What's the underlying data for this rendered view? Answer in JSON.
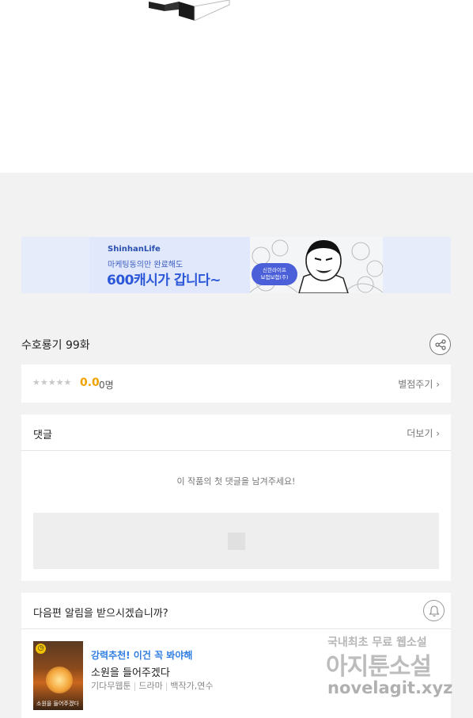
{
  "ad": {
    "brand": "ShinhanLife",
    "subline": "마케팅동의만 완료해도",
    "headline": "600캐시가 갑니다~",
    "badge_line1": "신한라이프",
    "badge_line2": "보험보험(주)"
  },
  "episode": {
    "title": "수호룡기 99화"
  },
  "rating": {
    "stars": "★★★★★",
    "score": "0.0",
    "count": "0명",
    "rate_label": "별점주기 ›"
  },
  "comments": {
    "title": "댓글",
    "more_label": "더보기 ›",
    "empty_message": "이 작품의 첫 댓글을 남겨주세요!"
  },
  "notify": {
    "question": "다음편 알림을 받으시겠습니까?"
  },
  "recommendation": {
    "tag": "강력추천! 이건 꼭 봐야해",
    "title": "소원을 들어주겠다",
    "genre1": "기다무웹툰",
    "genre2": "드라마",
    "author": "백작가,연수",
    "thumb_caption": "소원을 들어주겠다"
  },
  "watermark": {
    "line1": "국내최초 무료 웹소설",
    "line2": "아지툰소설",
    "line3": "novelagit.xyz"
  },
  "colors": {
    "accent_blue": "#2f7de1",
    "score_orange": "#f0a300",
    "ad_blue": "#2b57d8"
  }
}
